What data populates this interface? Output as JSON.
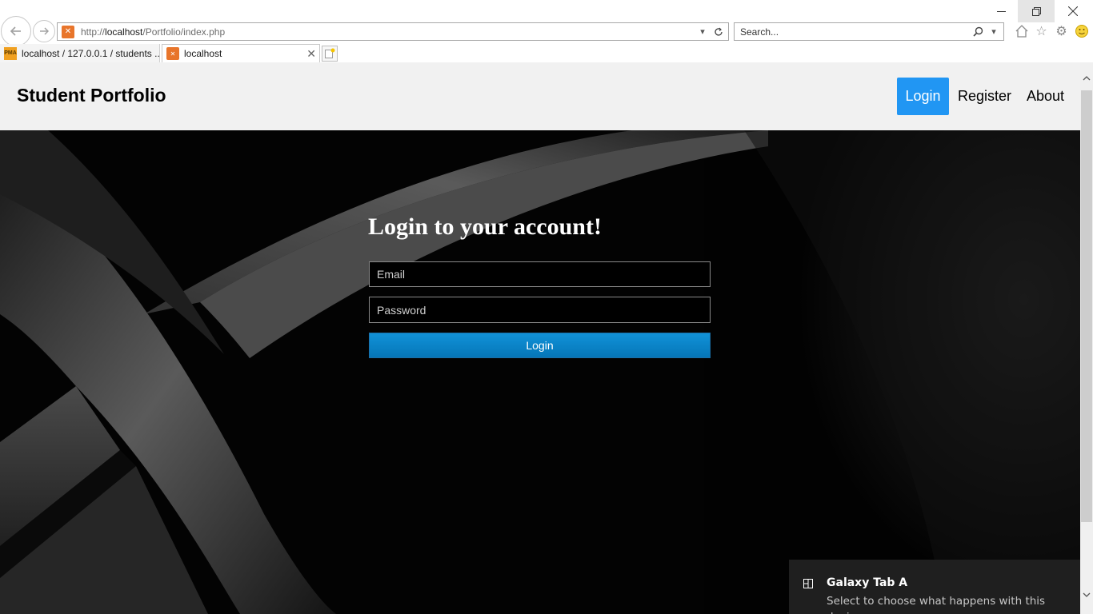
{
  "browser": {
    "url_prefix": "http://",
    "url_host": "localhost",
    "url_path": "/Portfolio/index.php",
    "search_placeholder": "Search...",
    "tabs": [
      {
        "label": "localhost / 127.0.0.1 / students ..."
      },
      {
        "label": "localhost"
      }
    ]
  },
  "site": {
    "brand": "Student Portfolio",
    "nav": {
      "login": "Login",
      "register": "Register",
      "about": "About"
    },
    "accent_color": "#2196f3"
  },
  "login_form": {
    "title": "Login to your account!",
    "email_placeholder": "Email",
    "password_placeholder": "Password",
    "submit_label": "Login"
  },
  "notification": {
    "title": "Galaxy Tab A",
    "message": "Select to choose what happens with this device."
  }
}
